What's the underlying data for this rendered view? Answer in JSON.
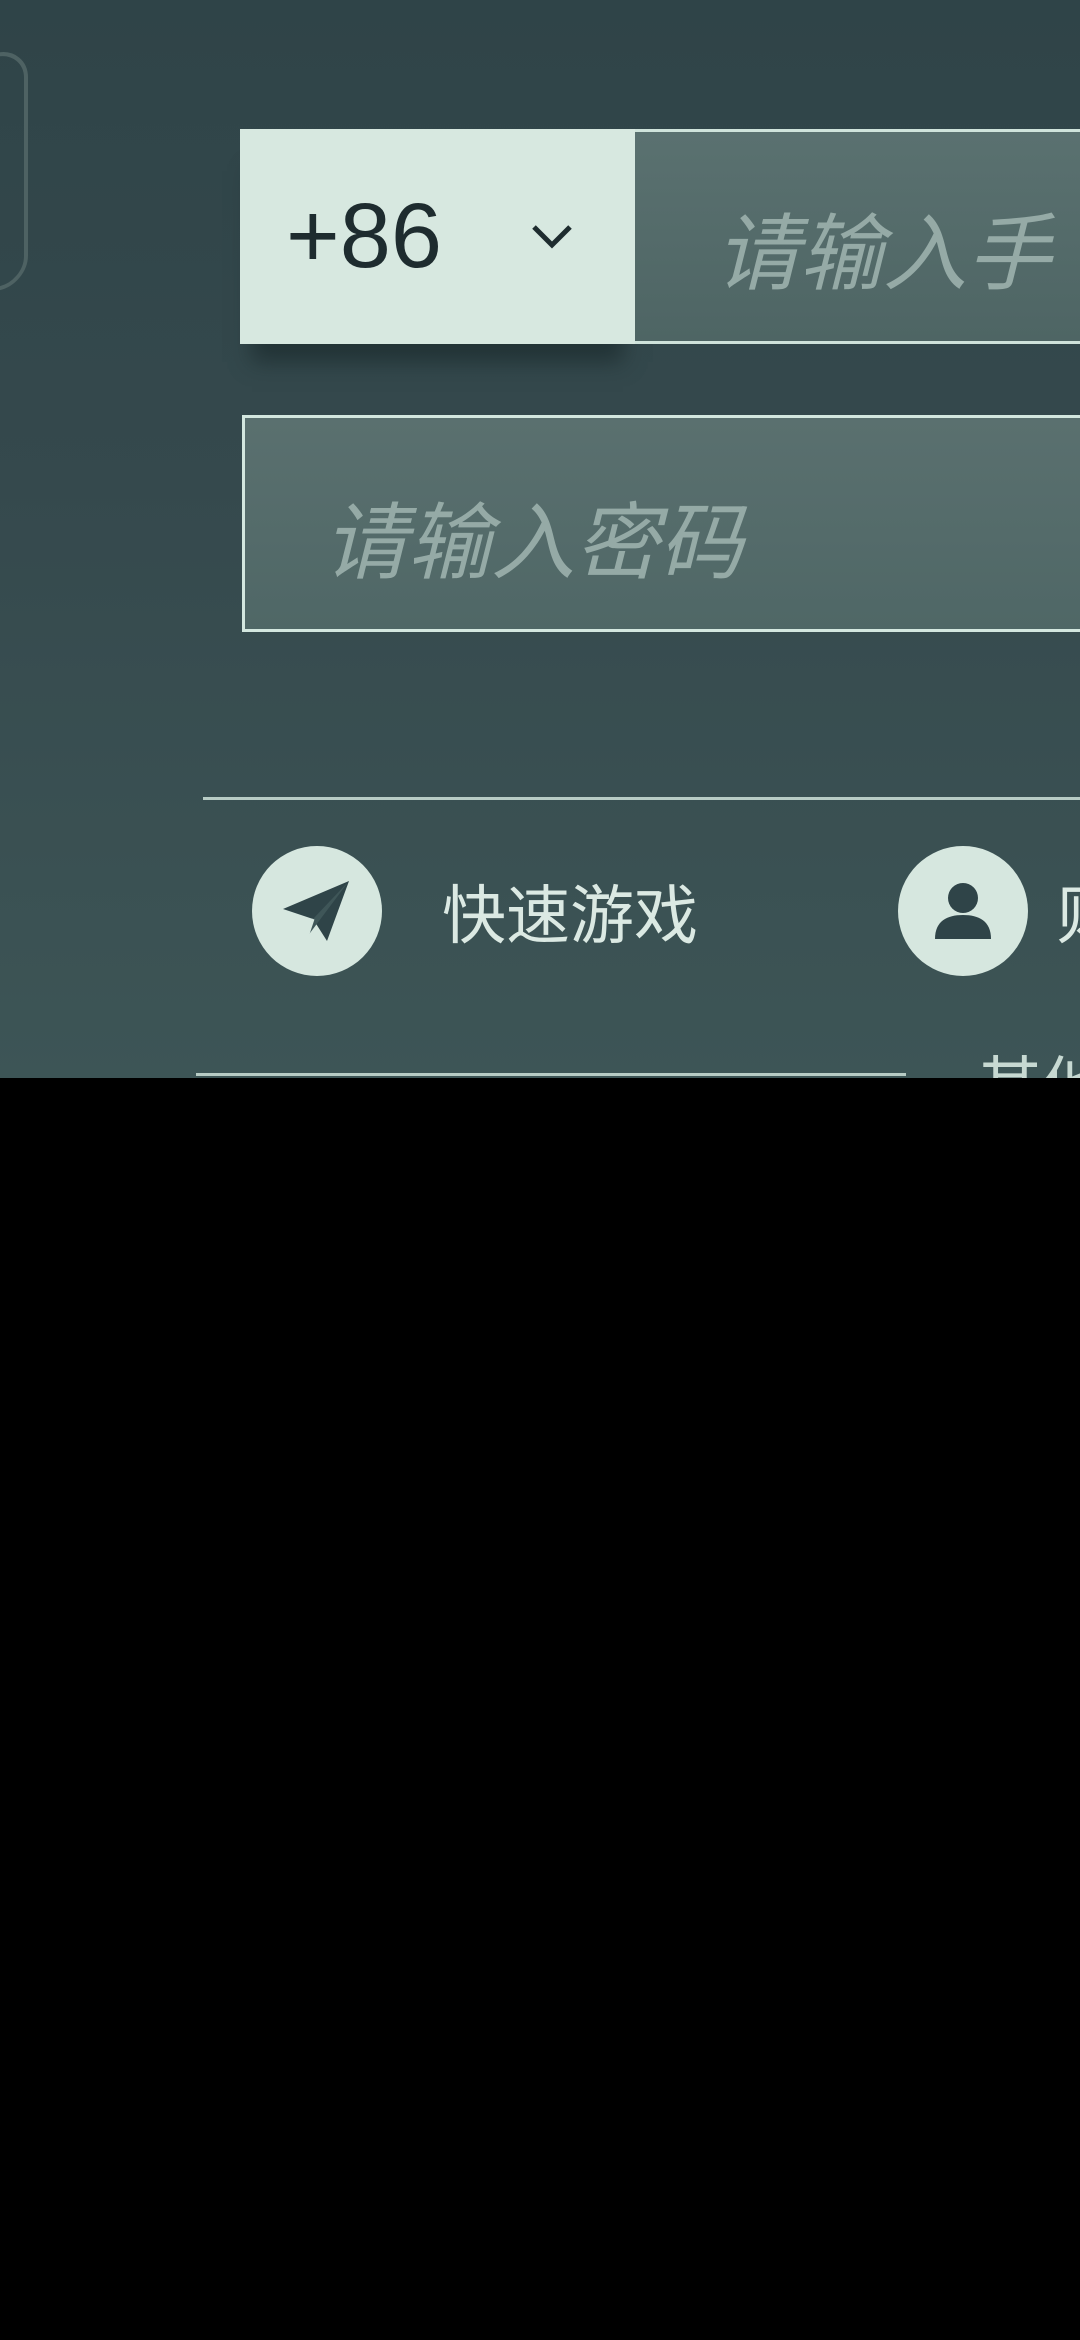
{
  "login": {
    "country_code": "+86",
    "phone_placeholder": "请输入手",
    "password_placeholder": "请输入密码"
  },
  "options": {
    "quick_game_label": "快速游戏",
    "account_label": "则",
    "other_label": "其他"
  },
  "colors": {
    "panel_bg": "#35494d",
    "accent_light": "#d7e8e0",
    "text_dark": "#1e2c2f",
    "placeholder": "#95aaa6"
  },
  "icons": {
    "dropdown": "chevron-down-icon",
    "quick_game": "paper-plane-icon",
    "account": "user-icon"
  }
}
